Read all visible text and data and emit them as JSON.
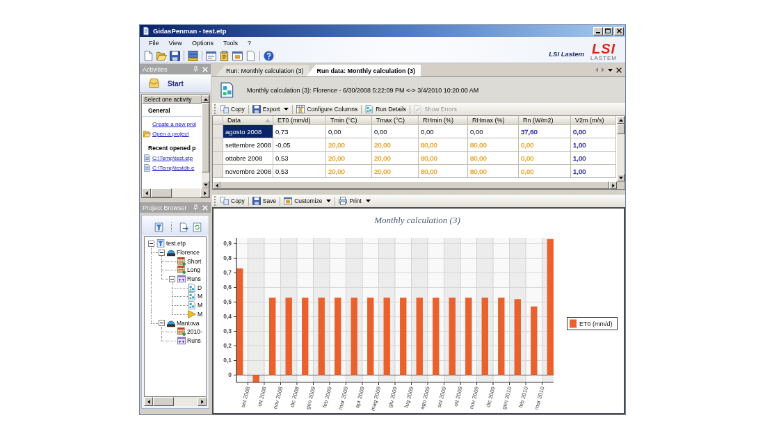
{
  "window": {
    "title": "GidasPenman - test.etp"
  },
  "menu": [
    "File",
    "View",
    "Options",
    "Tools",
    "?"
  ],
  "branding": {
    "name": "LSI Lastem",
    "logo": "LSI",
    "logo_caption": "LASTEM"
  },
  "activities": {
    "title": "Activities",
    "start": "Start",
    "list_title": "Select one activity",
    "sections": [
      {
        "heading": "General",
        "items": [
          {
            "label": "Create a new proj",
            "kind": "link"
          },
          {
            "label": "Open a project",
            "kind": "folder"
          }
        ]
      },
      {
        "heading": "Recent opened p",
        "items": [
          {
            "label": "C:\\Temp\\test.etp",
            "kind": "file"
          },
          {
            "label": "C:\\Temp\\testdb.e",
            "kind": "file"
          }
        ]
      }
    ]
  },
  "project_browser": {
    "title": "Project Browser",
    "tree": [
      {
        "label": "test.etp",
        "kind": "project",
        "expanded": true,
        "children": [
          {
            "label": "Florence",
            "kind": "station",
            "expanded": true,
            "children": [
              {
                "label": "Short",
                "kind": "table"
              },
              {
                "label": "Long",
                "kind": "table"
              },
              {
                "label": "Runs",
                "kind": "runs",
                "expanded": true,
                "children": [
                  {
                    "label": "D",
                    "kind": "run"
                  },
                  {
                    "label": "M",
                    "kind": "run"
                  },
                  {
                    "label": "M",
                    "kind": "run"
                  },
                  {
                    "label": "M",
                    "kind": "pending"
                  }
                ]
              }
            ]
          },
          {
            "label": "Mantova",
            "kind": "station",
            "expanded": true,
            "children": [
              {
                "label": "2010-",
                "kind": "table"
              },
              {
                "label": "Runs",
                "kind": "runs"
              }
            ]
          }
        ]
      }
    ]
  },
  "document": {
    "tabs": [
      {
        "label": "Run: Monthly calculation (3)",
        "selected": false
      },
      {
        "label": "Run data: Monthly calculation (3)",
        "selected": true
      }
    ],
    "header": "Monthly calculation (3): Florence - 6/30/2008 5:22:09 PM <-> 3/4/2010 10:20:00 AM",
    "grid_toolbar": [
      {
        "label": "Copy",
        "dropdown": false,
        "disabled": false
      },
      {
        "label": "Export",
        "dropdown": true,
        "disabled": false
      },
      {
        "label": "Configure Columns",
        "dropdown": false,
        "disabled": false
      },
      {
        "label": "Run Details",
        "dropdown": false,
        "disabled": false
      },
      {
        "label": "Show Errors",
        "dropdown": false,
        "disabled": true
      }
    ],
    "table": {
      "columns": [
        {
          "label": "Data",
          "sorted": true
        },
        {
          "label": "ET0 (mm/d)",
          "sorted": false
        },
        {
          "label": "Tmin (°C)",
          "sorted": false
        },
        {
          "label": "Tmax (°C)",
          "sorted": false
        },
        {
          "label": "RHmin (%)",
          "sorted": false
        },
        {
          "label": "RHmax (%)",
          "sorted": false
        },
        {
          "label": "Rn (W/m2)",
          "sorted": false
        },
        {
          "label": "V2m (m/s)",
          "sorted": false
        }
      ],
      "rows": [
        {
          "selected": true,
          "cells": [
            {
              "text": "agosto 2008"
            },
            {
              "text": "0,73"
            },
            {
              "text": "0,00"
            },
            {
              "text": "0,00"
            },
            {
              "text": "0,00"
            },
            {
              "text": "0,00"
            },
            {
              "text": "37,60",
              "color": "#2c2ca8"
            },
            {
              "text": "0,00",
              "color": "#2c2ca8"
            }
          ]
        },
        {
          "selected": false,
          "cells": [
            {
              "text": "settembre 2008"
            },
            {
              "text": "-0,05"
            },
            {
              "text": "20,00",
              "color": "#eca52e"
            },
            {
              "text": "20,00",
              "color": "#eca52e"
            },
            {
              "text": "80,00",
              "color": "#eca52e"
            },
            {
              "text": "80,00",
              "color": "#eca52e"
            },
            {
              "text": "0,00",
              "color": "#eca52e"
            },
            {
              "text": "1,00",
              "color": "#2c2ca8"
            }
          ]
        },
        {
          "selected": false,
          "cells": [
            {
              "text": "ottobre 2008"
            },
            {
              "text": "0,53"
            },
            {
              "text": "20,00",
              "color": "#eca52e"
            },
            {
              "text": "20,00",
              "color": "#eca52e"
            },
            {
              "text": "80,00",
              "color": "#eca52e"
            },
            {
              "text": "80,00",
              "color": "#eca52e"
            },
            {
              "text": "0,00",
              "color": "#eca52e"
            },
            {
              "text": "1,00",
              "color": "#2c2ca8"
            }
          ]
        },
        {
          "selected": false,
          "cells": [
            {
              "text": "novembre 2008"
            },
            {
              "text": "0,53"
            },
            {
              "text": "20,00",
              "color": "#eca52e"
            },
            {
              "text": "20,00",
              "color": "#eca52e"
            },
            {
              "text": "80,00",
              "color": "#eca52e"
            },
            {
              "text": "80,00",
              "color": "#eca52e"
            },
            {
              "text": "0,00",
              "color": "#eca52e"
            },
            {
              "text": "1,00",
              "color": "#2c2ca8"
            }
          ]
        }
      ]
    },
    "chart_toolbar": [
      {
        "label": "Copy",
        "dropdown": false
      },
      {
        "label": "Save",
        "dropdown": false
      },
      {
        "label": "Customize",
        "dropdown": true
      },
      {
        "label": "Print",
        "dropdown": true
      }
    ],
    "chart": {
      "chart_data": {
        "type": "bar",
        "title": "Monthly calculation (3)",
        "categories": [
          null,
          "set 2008",
          "ott 2008",
          "nov 2008",
          "dic 2008",
          "gen 2009",
          "feb 2009",
          "mar 2009",
          "apr 2009",
          "mag 2009",
          "giu 2009",
          "lug 2009",
          "ago 2009",
          "set 2009",
          "ott 2009",
          "nov 2009",
          "dic 2009",
          "gen 2010",
          "feb 2010",
          "mar 2010"
        ],
        "series": [
          {
            "name": "ET0 (mm/d)",
            "color": "#e9622d",
            "values": [
              0.73,
              -0.05,
              0.53,
              0.53,
              0.53,
              0.53,
              0.53,
              0.53,
              0.53,
              0.53,
              0.53,
              0.53,
              0.53,
              0.53,
              0.53,
              0.53,
              0.53,
              0.52,
              0.47,
              0.93
            ]
          }
        ],
        "ylim": [
          -0.05,
          0.94
        ],
        "yticks": [
          {
            "value": 0,
            "label": "0"
          },
          {
            "value": 0.1,
            "label": "0,1"
          },
          {
            "value": 0.2,
            "label": "0,2"
          },
          {
            "value": 0.3,
            "label": "0,3"
          },
          {
            "value": 0.4,
            "label": "0,4"
          },
          {
            "value": 0.5,
            "label": "0,5"
          },
          {
            "value": 0.6,
            "label": "0,6"
          },
          {
            "value": 0.7,
            "label": "0,7"
          },
          {
            "value": 0.8,
            "label": "0,8"
          },
          {
            "value": 0.9,
            "label": "0,9"
          }
        ],
        "grid": true
      }
    }
  }
}
